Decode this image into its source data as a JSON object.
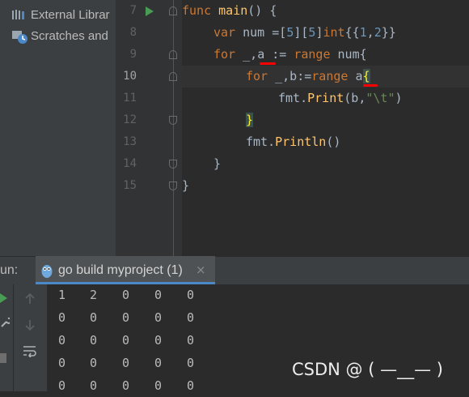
{
  "sidebar": {
    "items": [
      {
        "label": "External Librar",
        "icon": "library-icon"
      },
      {
        "label": "Scratches and",
        "icon": "scratches-icon"
      }
    ]
  },
  "editor": {
    "line_numbers": [
      "7",
      "8",
      "9",
      "10",
      "11",
      "12",
      "13",
      "14",
      "15"
    ],
    "current_line": "10",
    "code": {
      "l7": {
        "kw": "func",
        "fn": "main",
        "rest": "() {"
      },
      "l8": {
        "kw": "var",
        "a": " num =[",
        "n1": "5",
        "b": "][",
        "n2": "5",
        "c": "]",
        "kw2": "int",
        "d": "{{",
        "n3": "1",
        "e": ",",
        "n4": "2",
        "f": "}}"
      },
      "l9": {
        "kw": "for",
        "a": " _,",
        "v": "a",
        "b": " := ",
        "kw2": "range",
        "c": " num{"
      },
      "l10": {
        "kw": "for",
        "a": " _,b:=",
        "kw2": "range",
        "b": " ",
        "v": "a",
        "brace": "{"
      },
      "l11": {
        "a": "fmt.",
        "fn": "Print",
        "b": "(b,",
        "str": "\"\\t\"",
        "c": ")"
      },
      "l12": {
        "brace": "}"
      },
      "l13": {
        "a": "fmt.",
        "fn": "Println",
        "b": "()"
      },
      "l14": {
        "a": "}"
      },
      "l15": {
        "a": "}"
      }
    }
  },
  "run": {
    "label": "un:",
    "tab_label": "go build myproject (1)",
    "close_glyph": "×",
    "output": [
      [
        "1",
        "2",
        "0",
        "0",
        "0"
      ],
      [
        "0",
        "0",
        "0",
        "0",
        "0"
      ],
      [
        "0",
        "0",
        "0",
        "0",
        "0"
      ],
      [
        "0",
        "0",
        "0",
        "0",
        "0"
      ],
      [
        "0",
        "0",
        "0",
        "0",
        "0"
      ]
    ]
  },
  "watermark": "CSDN @ ( —__— )",
  "colors": {
    "keyword": "#cc7832",
    "function": "#ffc66d",
    "number": "#6897bb",
    "string": "#6a8759",
    "underline": "#ff0000",
    "run_arrow": "#499c54"
  }
}
